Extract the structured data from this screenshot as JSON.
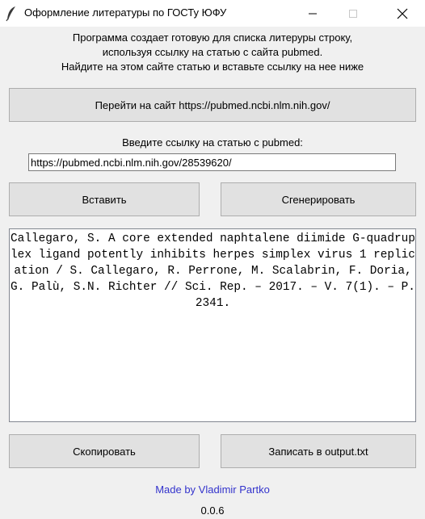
{
  "window": {
    "title": "Оформление литературы по ГОСТу ЮФУ",
    "controls": {
      "minimize": "minimize-icon",
      "maximize": "maximize-icon",
      "close": "close-icon"
    }
  },
  "description": {
    "line1": "Программа создает готовую для списка литеруры строку,",
    "line2": "используя ссылку на статью с сайта pubmed.",
    "line3": "Найдите на этом сайте статью и вставьте ссылку на нее ниже"
  },
  "open_site_button": "Перейти на сайт https://pubmed.ncbi.nlm.nih.gov/",
  "url_label": "Введите ссылку на статью с pubmed:",
  "url_input_value": "https://pubmed.ncbi.nlm.nih.gov/28539620/",
  "paste_button": "Вставить",
  "generate_button": "Сгенерировать",
  "output_text": "Callegaro, S. A core extended naphtalene diimide G-quadruplex ligand potently inhibits herpes simplex virus 1 replication / S. Callegaro, R. Perrone, M. Scalabrin, F. Doria, G. Palù, S.N. Richter // Sci. Rep. – 2017. – V. 7(1). – P. 2341.",
  "copy_button": "Скопировать",
  "write_button": "Записать в output.txt",
  "credit": "Made by Vladimir Partko",
  "version": "0.0.6",
  "colors": {
    "window_bg": "#f0f0f0",
    "button_bg": "#e1e1e1",
    "credit": "#3333cc"
  }
}
